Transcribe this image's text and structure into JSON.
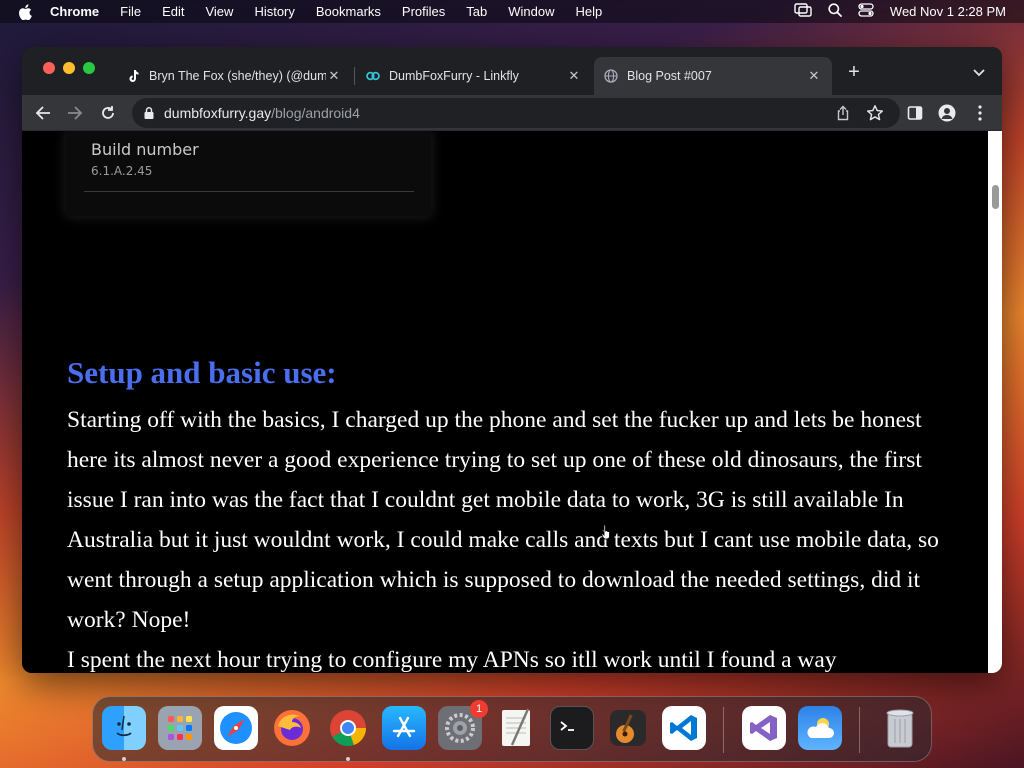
{
  "menubar": {
    "app_name": "Chrome",
    "items": [
      "File",
      "Edit",
      "View",
      "History",
      "Bookmarks",
      "Profiles",
      "Tab",
      "Window",
      "Help"
    ],
    "clock": "Wed Nov 1  2:28 PM"
  },
  "tabs": [
    {
      "title": "Bryn The Fox (she/they) (@dumbfoxfurry)",
      "icon": "tiktok-icon",
      "active": false
    },
    {
      "title": "DumbFoxFurry - Linkfly",
      "icon": "linkfly-icon",
      "active": false
    },
    {
      "title": "Blog Post #007",
      "icon": "globe-icon",
      "active": true
    }
  ],
  "omnibox": {
    "domain": "dumbfoxfurry.gay",
    "path": "/blog/android4"
  },
  "page": {
    "settings_item": {
      "label": "Build number",
      "value": "6.1.A.2.45"
    },
    "heading": "Setup and basic use:",
    "paragraphs": [
      "Starting off with the basics, I charged up the phone and set the fucker up and lets be honest here its almost never a good experience trying to set up one of these old dinosaurs, the first issue I ran into was the fact that I couldnt get mobile data to work, 3G is still available In Australia but it just wouldnt work, I could make calls and texts but I cant use mobile data, so went through a setup application which is supposed to download the needed settings, did it work? Nope!",
      "I spent the next hour trying to configure my APNs so itll work until I found a way"
    ]
  },
  "dock": {
    "apps": [
      "Finder",
      "Launchpad",
      "Safari",
      "Firefox",
      "Google Chrome",
      "App Store",
      "System Settings",
      "TextEdit",
      "Terminal",
      "GarageBand",
      "Visual Studio Code",
      "Visual Studio",
      "Weather",
      "Trash"
    ],
    "system_settings_badge": "1"
  },
  "colors": {
    "heading": "#4a6ef0",
    "page_background": "#000000",
    "body_text": "#ffffff"
  }
}
